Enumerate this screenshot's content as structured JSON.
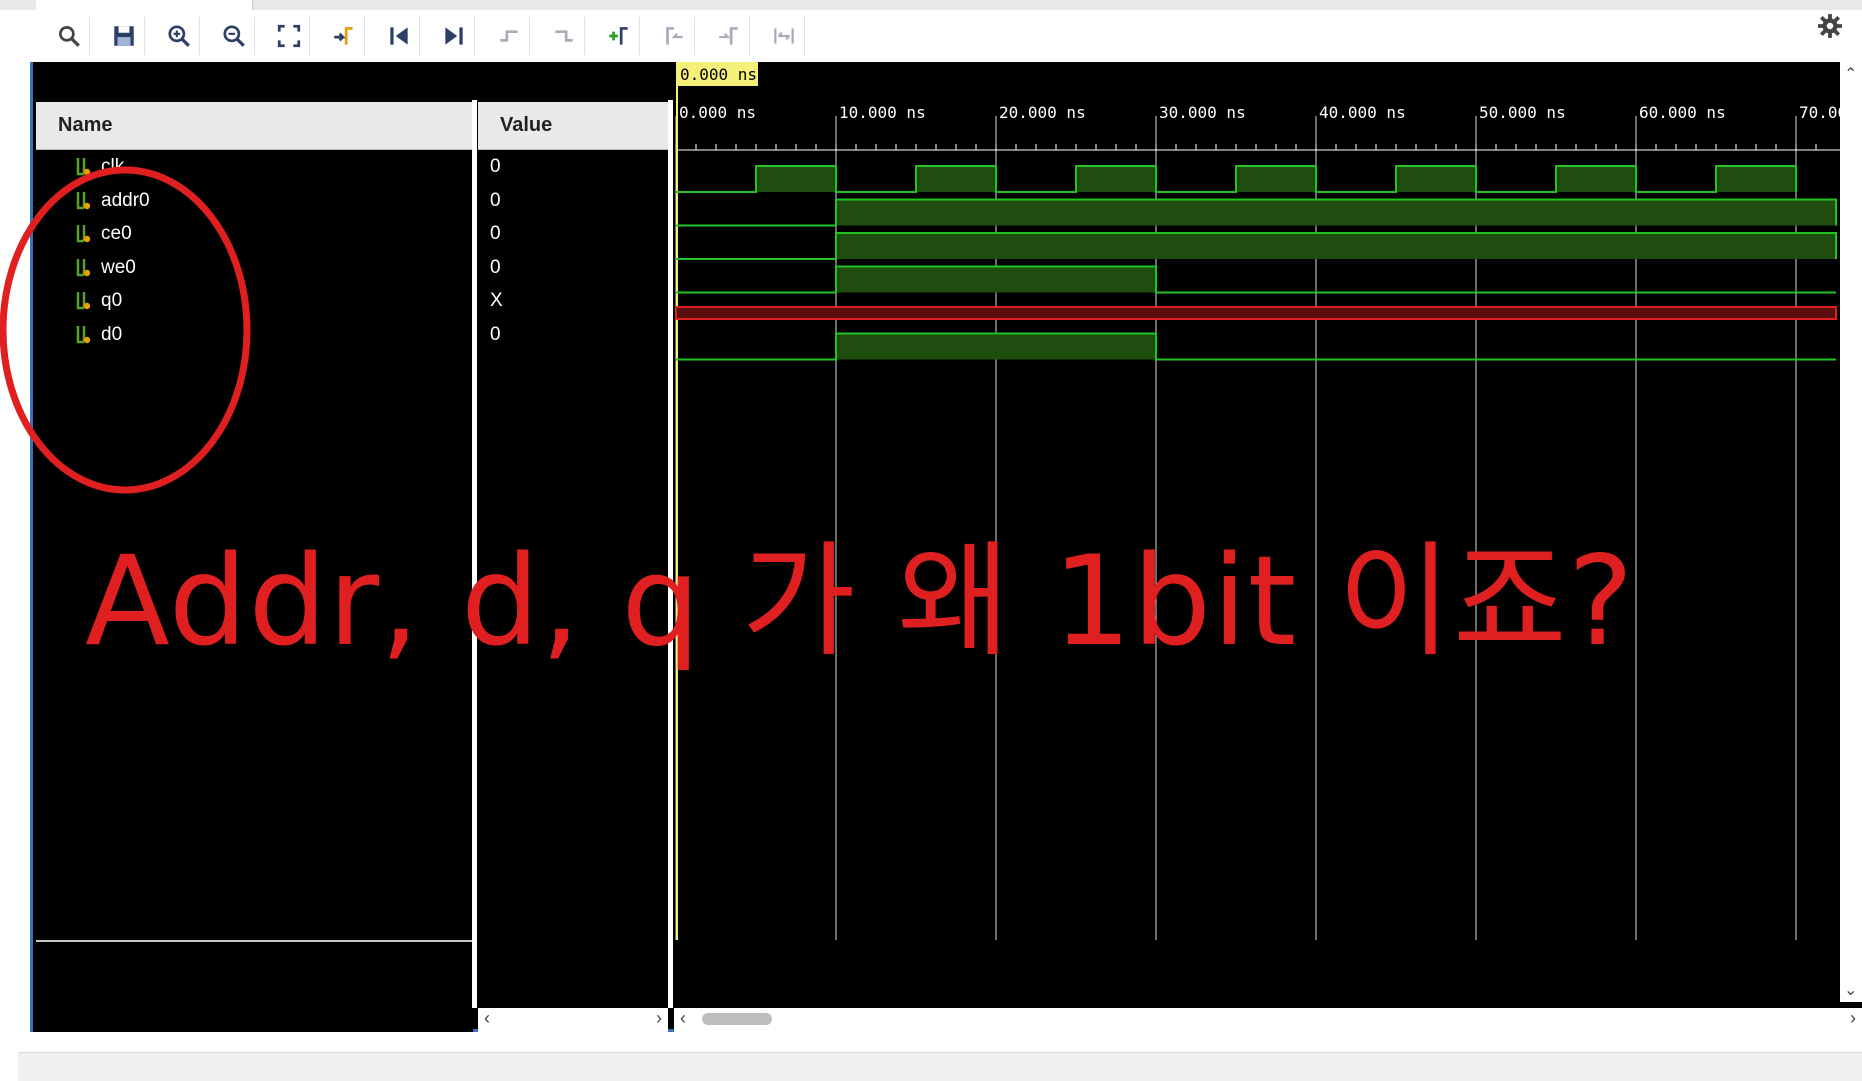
{
  "toolbar": {
    "icons": [
      "search-icon",
      "save-icon",
      "zoom-in-icon",
      "zoom-out-icon",
      "zoom-fit-icon",
      "go-to-cursor-icon",
      "go-to-start-icon",
      "go-to-end-icon",
      "previous-transition-icon",
      "next-transition-icon",
      "add-marker-icon",
      "previous-marker-icon",
      "next-marker-icon",
      "swap-cursors-icon"
    ],
    "settings_icon": "gear-icon"
  },
  "columns": {
    "name": "Name",
    "value": "Value"
  },
  "signals": [
    {
      "name": "clk",
      "value": "0"
    },
    {
      "name": "addr0",
      "value": "0"
    },
    {
      "name": "ce0",
      "value": "0"
    },
    {
      "name": "we0",
      "value": "0"
    },
    {
      "name": "q0",
      "value": "X"
    },
    {
      "name": "d0",
      "value": "0"
    }
  ],
  "timeline": {
    "cursor_label": "0.000 ns",
    "tick_labels": [
      "0.000 ns",
      "10.000 ns",
      "20.000 ns",
      "30.000 ns",
      "40.000 ns",
      "50.000 ns",
      "60.000 ns",
      "70.00"
    ],
    "start_ns": 0,
    "end_ns": 72.5
  },
  "waveforms": {
    "clk": {
      "type": "clock",
      "period_ns": 10,
      "high_start_ns": 5
    },
    "addr0": {
      "type": "bit",
      "high_from_ns": 10,
      "high_to_ns": 72.5
    },
    "ce0": {
      "type": "bit",
      "high_from_ns": 10,
      "high_to_ns": 72.5
    },
    "we0": {
      "type": "bit",
      "high_from_ns": 10,
      "high_to_ns": 30
    },
    "q0": {
      "type": "unknown"
    },
    "d0": {
      "type": "bit",
      "high_from_ns": 10,
      "high_to_ns": 30
    }
  },
  "colors": {
    "wave": "#22c322",
    "wave_fill": "#1f4d10",
    "unknown": "#e02020",
    "unknown_fill": "#5a0f0f",
    "annotation": "#e02020",
    "cursor": "#f5f078"
  },
  "annotation": {
    "text": "Addr, d, q 가 왜 1bit 이죠?"
  }
}
